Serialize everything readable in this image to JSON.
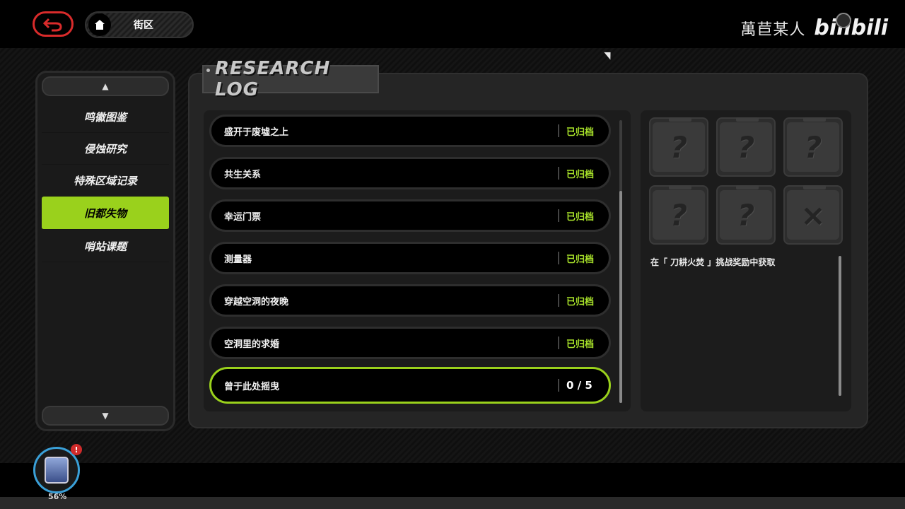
{
  "header": {
    "breadcrumb_label": "街区",
    "watermark_author": "萬苣某人",
    "watermark_logo": "bilibili"
  },
  "sidebar": {
    "items": [
      {
        "label": "鸣徽图鉴",
        "active": false
      },
      {
        "label": "侵蚀研究",
        "active": false
      },
      {
        "label": "特殊区域记录",
        "active": false
      },
      {
        "label": "旧都失物",
        "active": true
      },
      {
        "label": "哨站课题",
        "active": false
      }
    ]
  },
  "main": {
    "title": "RESEARCH LOG",
    "rows": [
      {
        "name": "盛开于废墟之上",
        "status": "已归档"
      },
      {
        "name": "共生关系",
        "status": "已归档"
      },
      {
        "name": "幸运门票",
        "status": "已归档"
      },
      {
        "name": "测量器",
        "status": "已归档"
      },
      {
        "name": "穿越空洞的夜晚",
        "status": "已归档"
      },
      {
        "name": "空洞里的求婚",
        "status": "已归档"
      },
      {
        "name": "曾于此处摇曳",
        "status": "0 / 5"
      }
    ],
    "detail": {
      "description": "在「 刀耕火焚 」挑战奖励中获取",
      "clues": [
        "?",
        "?",
        "?",
        "?",
        "?",
        "×"
      ]
    }
  },
  "status": {
    "battery": "56%",
    "alert": "!"
  },
  "colors": {
    "accent": "#9ad11c",
    "archived": "#a8e22a",
    "back": "#d92b2b"
  }
}
